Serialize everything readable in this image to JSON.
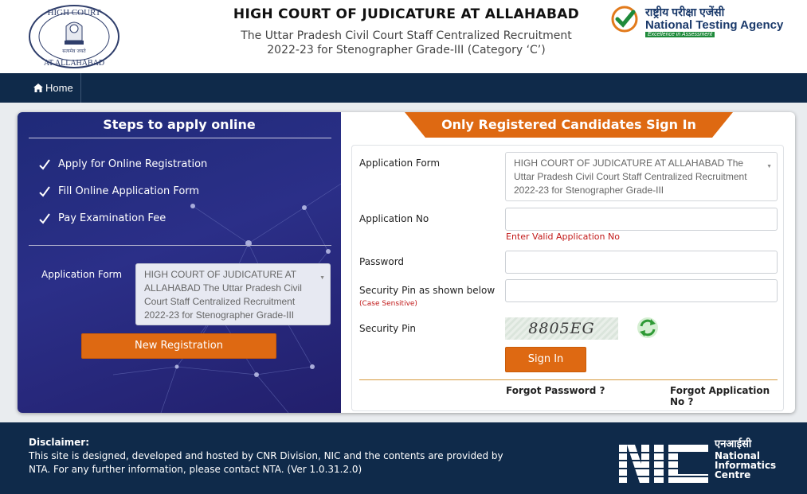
{
  "header": {
    "seal_top_text": "HIGH COURT",
    "seal_bottom_text": "AT ALLAHABAD",
    "seal_motto": "सत्यमेव जयते",
    "title": "HIGH COURT OF JUDICATURE AT ALLAHABAD",
    "subtitle_line1": "The Uttar Pradesh Civil Court Staff Centralized Recruitment",
    "subtitle_line2": "2022-23 for Stenographer Grade-III (Category ‘C’)",
    "nta_hindi": "राष्ट्रीय परीक्षा एजेंसी",
    "nta_name": "National Testing Agency",
    "nta_tagline": "Excellence in Assessment"
  },
  "nav": {
    "home_label": "Home"
  },
  "steps": {
    "title": "Steps to apply online",
    "items": [
      "Apply for Online Registration",
      "Fill Online Application Form",
      "Pay Examination Fee"
    ],
    "application_form_label": "Application Form",
    "application_form_value": "HIGH COURT OF JUDICATURE AT ALLAHABAD The Uttar Pradesh Civil Court Staff Centralized Recruitment 2022-23 for Stenographer Grade-III",
    "new_registration_label": "New Registration"
  },
  "signin": {
    "title": "Only Registered Candidates Sign In",
    "application_form_label": "Application Form",
    "application_form_value": "HIGH COURT OF JUDICATURE AT ALLAHABAD The Uttar Pradesh Civil Court Staff Centralized Recruitment 2022-23 for Stenographer Grade-III",
    "application_no_label": "Application No",
    "application_no_value": "",
    "application_no_error": "Enter Valid Application No",
    "password_label": "Password",
    "password_value": "",
    "security_pin_shown_label": "Security Pin as shown below",
    "case_sensitive_note": "(Case Sensitive)",
    "security_pin_input_value": "",
    "security_pin_label": "Security Pin",
    "captcha_text": "8805EG",
    "sign_in_label": "Sign In",
    "forgot_password_label": "Forgot Password ?",
    "forgot_application_no_label": "Forgot Application No ?"
  },
  "footer": {
    "disclaimer_title": "Disclaimer:",
    "disclaimer_text": "This site is designed, developed and hosted by CNR Division, NIC and the contents are provided by NTA. For any further information, please contact NTA. (Ver 1.0.31.2.0)",
    "nic_hindi": "एनआईसी",
    "nic_line1": "National",
    "nic_line2": "Informatics",
    "nic_line3": "Centre"
  },
  "colors": {
    "navy": "#0f2a4a",
    "orange": "#de6912",
    "error_red": "#c21818"
  }
}
